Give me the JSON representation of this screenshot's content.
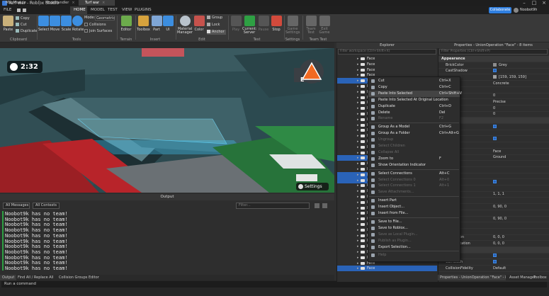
{
  "window": {
    "title": "Turf war - Roblox Studio"
  },
  "ribbon_tabs": [
    "FILE",
    "HOME",
    "MODEL",
    "TEST",
    "VIEW",
    "PLUGINS"
  ],
  "ribbon_active": "HOME",
  "collaborate_label": "Collaborate",
  "user": {
    "name": "Noobot9h"
  },
  "clipboard": {
    "paste": "Paste",
    "copy": "Copy",
    "cut": "Cut",
    "duplicate": "Duplicate",
    "group": "Clipboard"
  },
  "tools": {
    "select": "Select",
    "move": "Move",
    "scale": "Scale",
    "rotate": "Rotate",
    "mode_label": "Mode:",
    "mode_value": "Geometric",
    "collisions": "Collisions",
    "join_surfaces": "Join Surfaces",
    "group": "Tools"
  },
  "terrain": {
    "editor": "Editor",
    "group": "Terrain"
  },
  "insert": {
    "toolbox": "Toolbox",
    "part": "Part",
    "ui": "UI",
    "group": "Insert"
  },
  "edit": {
    "material": "Material Manager",
    "color": "Color",
    "group_btn": "Group",
    "lock": "Lock",
    "anchor": "Anchor",
    "group": "Edit"
  },
  "test": {
    "play": "Play",
    "resume": "Resume",
    "current": "Current: Server",
    "pause": "Pause",
    "stop": "Stop",
    "group": "Test"
  },
  "settings": {
    "game_settings": "Game Settings",
    "group": "Settings"
  },
  "team_test": {
    "team": "Team Test",
    "exit": "Exit Game",
    "group": "Team Test"
  },
  "doc_tabs": [
    {
      "label": "MapModule",
      "active": false
    },
    {
      "label": "ModeHandler",
      "active": false
    },
    {
      "label": "Turf war",
      "active": true
    }
  ],
  "hud": {
    "timer": "2:32",
    "settings_label": "Settings",
    "objective_key": "E"
  },
  "output": {
    "title": "Output",
    "messages_filter": "All Messages",
    "contexts_filter": "All Contexts",
    "filter_placeholder": "Filter...",
    "lines": [
      "Noobot9k has no team!",
      "Noobot9k has no team!",
      "Noobot9k has no team!",
      "Noobot9k has no team!",
      "Noobot9k has no team!",
      "Noobot9k has no team!",
      "Noobot9k has no team!",
      "Noobot9k has no team!",
      "Noobot9k has no team!",
      "Noobot9k has no team!",
      "Noobot9k has no team!"
    ]
  },
  "bottom_tabs": [
    "Output",
    "Find All / Replace All",
    "Collision Groups Editor"
  ],
  "command_bar": {
    "placeholder": "Run a command"
  },
  "explorer": {
    "title": "Explorer",
    "filter_placeholder": "Filter workspace (Ctrl+Shift+X)",
    "rows": [
      {
        "label": "Face",
        "selected": false
      },
      {
        "label": "Face",
        "selected": false
      },
      {
        "label": "Face",
        "selected": false
      },
      {
        "label": "Face",
        "selected": false
      },
      {
        "label": "Face",
        "selected": true
      },
      {
        "label": "Fa",
        "selected": false
      },
      {
        "label": "Fa",
        "selected": false
      },
      {
        "label": "Fa",
        "selected": false
      },
      {
        "label": "Fa",
        "selected": false
      },
      {
        "label": "Fa",
        "selected": false
      },
      {
        "label": "Fa",
        "selected": false
      },
      {
        "label": "Fa",
        "selected": false
      },
      {
        "label": "Fa",
        "selected": false
      },
      {
        "label": "Fa",
        "selected": false
      },
      {
        "label": "Fa",
        "selected": false
      },
      {
        "label": "Fa",
        "selected": false
      },
      {
        "label": "Fa",
        "selected": false
      },
      {
        "label": "Fa",
        "selected": false
      },
      {
        "label": "Fa",
        "selected": true
      },
      {
        "label": "Fa",
        "selected": false
      },
      {
        "label": "Fa",
        "selected": false
      },
      {
        "label": "Fa",
        "selected": true
      },
      {
        "label": "Fa",
        "selected": true
      },
      {
        "label": "Fa",
        "selected": false
      },
      {
        "label": "Fa",
        "selected": false
      },
      {
        "label": "Fa",
        "selected": false
      },
      {
        "label": "Fa",
        "selected": false
      },
      {
        "label": "Fa",
        "selected": false
      },
      {
        "label": "Fa",
        "selected": false
      },
      {
        "label": "Fa",
        "selected": false
      },
      {
        "label": "Fa",
        "selected": false
      },
      {
        "label": "Fa",
        "selected": false
      },
      {
        "label": "Fa",
        "selected": false
      },
      {
        "label": "Fa",
        "selected": false
      },
      {
        "label": "Fa",
        "selected": false
      },
      {
        "label": "Fa",
        "selected": false
      },
      {
        "label": "Fa",
        "selected": false
      },
      {
        "label": "Face",
        "selected": false
      },
      {
        "label": "Face",
        "selected": true
      }
    ]
  },
  "context_menu": {
    "items": [
      {
        "label": "Cut",
        "shortcut": "Ctrl+X",
        "disabled": false,
        "sep_before": false
      },
      {
        "label": "Copy",
        "shortcut": "Ctrl+C",
        "disabled": false,
        "sep_before": false
      },
      {
        "label": "Paste Into Selected",
        "shortcut": "Ctrl+Shift+V",
        "disabled": false,
        "sep_before": false
      },
      {
        "label": "Paste Into Selected At Original Location",
        "shortcut": "",
        "disabled": false,
        "sep_before": false
      },
      {
        "label": "Duplicate",
        "shortcut": "Ctrl+D",
        "disabled": false,
        "sep_before": false
      },
      {
        "label": "Delete",
        "shortcut": "Del",
        "disabled": false,
        "sep_before": false
      },
      {
        "label": "Rename",
        "shortcut": "F2",
        "disabled": true,
        "sep_before": false
      },
      {
        "label": "Group As a Model",
        "shortcut": "Ctrl+G",
        "disabled": false,
        "sep_before": true
      },
      {
        "label": "Group As a Folder",
        "shortcut": "Ctrl+Alt+G",
        "disabled": false,
        "sep_before": false
      },
      {
        "label": "Ungroup",
        "shortcut": "",
        "disabled": true,
        "sep_before": false
      },
      {
        "label": "Select Children",
        "shortcut": "",
        "disabled": true,
        "sep_before": false
      },
      {
        "label": "Collapse All",
        "shortcut": "",
        "disabled": true,
        "sep_before": false
      },
      {
        "label": "Zoom to",
        "shortcut": "F",
        "disabled": false,
        "sep_before": false
      },
      {
        "label": "Show Orientation Indicator",
        "shortcut": "",
        "disabled": false,
        "sep_before": false
      },
      {
        "label": "Select Connections",
        "shortcut": "Alt+C",
        "disabled": false,
        "sep_before": true
      },
      {
        "label": "Select Connections 0",
        "shortcut": "Alt+0",
        "disabled": true,
        "sep_before": false
      },
      {
        "label": "Select Connections 1",
        "shortcut": "Alt+1",
        "disabled": true,
        "sep_before": false
      },
      {
        "label": "Save Attachments...",
        "shortcut": "",
        "disabled": true,
        "sep_before": false
      },
      {
        "label": "Insert Part",
        "shortcut": "",
        "disabled": false,
        "sep_before": true
      },
      {
        "label": "Insert Object...",
        "shortcut": "",
        "disabled": false,
        "sep_before": false
      },
      {
        "label": "Insert from File...",
        "shortcut": "",
        "disabled": false,
        "sep_before": false
      },
      {
        "label": "Save to File...",
        "shortcut": "",
        "disabled": false,
        "sep_before": true
      },
      {
        "label": "Save to Roblox...",
        "shortcut": "",
        "disabled": false,
        "sep_before": false
      },
      {
        "label": "Save as Local Plugin...",
        "shortcut": "",
        "disabled": true,
        "sep_before": false
      },
      {
        "label": "Publish as Plugin...",
        "shortcut": "",
        "disabled": true,
        "sep_before": false
      },
      {
        "label": "Export Selection...",
        "shortcut": "",
        "disabled": false,
        "sep_before": false
      },
      {
        "label": "Help",
        "shortcut": "",
        "disabled": true,
        "sep_before": true
      }
    ]
  },
  "properties": {
    "title": "Properties - UnionOperation \"Face\" - 8 items",
    "filter_placeholder": "Filter Properties (Ctrl+Shift+P)",
    "rows": [
      {
        "name": "Appearance",
        "value": "",
        "category": true,
        "kind": ""
      },
      {
        "name": "BrickColor",
        "value": "Grey",
        "category": false,
        "kind": "swatch",
        "swatch": "#8c8c8c"
      },
      {
        "name": "CastShadow",
        "value": "",
        "category": false,
        "kind": "check"
      },
      {
        "name": "",
        "value": "[159, 159, 159]",
        "category": false,
        "kind": "swatch",
        "swatch": "#9f9f9f"
      },
      {
        "name": "",
        "value": "Concrete",
        "category": false,
        "kind": ""
      },
      {
        "name": "ant",
        "value": "",
        "category": false,
        "kind": ""
      },
      {
        "name": "",
        "value": "0",
        "category": false,
        "kind": ""
      },
      {
        "name": "lity",
        "value": "Precise",
        "category": false,
        "kind": ""
      },
      {
        "name": "gAngle",
        "value": "0",
        "category": false,
        "kind": ""
      },
      {
        "name": "cy",
        "value": "0",
        "category": false,
        "kind": ""
      },
      {
        "name": "",
        "value": "",
        "category": true,
        "kind": ""
      },
      {
        "name": "",
        "value": "",
        "category": false,
        "kind": "check"
      },
      {
        "name": "",
        "value": "",
        "category": false,
        "kind": ""
      },
      {
        "name": "",
        "value": "",
        "category": false,
        "kind": "check"
      },
      {
        "name": "",
        "value": "",
        "category": false,
        "kind": ""
      },
      {
        "name": "",
        "value": "Face",
        "category": false,
        "kind": ""
      },
      {
        "name": "",
        "value": "Ground",
        "category": false,
        "kind": ""
      },
      {
        "name": "",
        "value": "",
        "category": false,
        "kind": ""
      },
      {
        "name": "",
        "value": "",
        "category": false,
        "kind": ""
      },
      {
        "name": "",
        "value": "",
        "category": false,
        "kind": ""
      },
      {
        "name": "olor",
        "value": "",
        "category": false,
        "kind": "check"
      },
      {
        "name": "",
        "value": "",
        "category": false,
        "kind": ""
      },
      {
        "name": "",
        "value": "1, 1, 1",
        "category": false,
        "kind": ""
      },
      {
        "name": "",
        "value": "",
        "category": false,
        "kind": ""
      },
      {
        "name": "n",
        "value": "0, 90, 0",
        "category": false,
        "kind": ""
      },
      {
        "name": "",
        "value": "",
        "category": false,
        "kind": ""
      },
      {
        "name": "ation",
        "value": "0, 90, 0",
        "category": false,
        "kind": ""
      },
      {
        "name": "",
        "value": "",
        "category": false,
        "kind": ""
      },
      {
        "name": "",
        "value": "",
        "category": false,
        "kind": ""
      },
      {
        "name": "et Position",
        "value": "0, 0, 0",
        "category": false,
        "kind": ""
      },
      {
        "name": "et Orientation",
        "value": "0, 0, 0",
        "category": false,
        "kind": ""
      },
      {
        "name": "",
        "value": "",
        "category": true,
        "kind": ""
      },
      {
        "name": "",
        "value": "",
        "category": false,
        "kind": "check"
      },
      {
        "name": "CanTouch",
        "value": "",
        "category": false,
        "kind": "check"
      },
      {
        "name": "CollisionFidelity",
        "value": "Default",
        "category": false,
        "kind": ""
      }
    ]
  },
  "properties_tabs": [
    "Properties - UnionOperation \"Face\" - 8 items",
    "Asset Manager",
    "Toolbox"
  ],
  "colors": {
    "accent": "#2f7fe0",
    "selection": "#2a63b8",
    "log_marker": "#2ea043"
  }
}
